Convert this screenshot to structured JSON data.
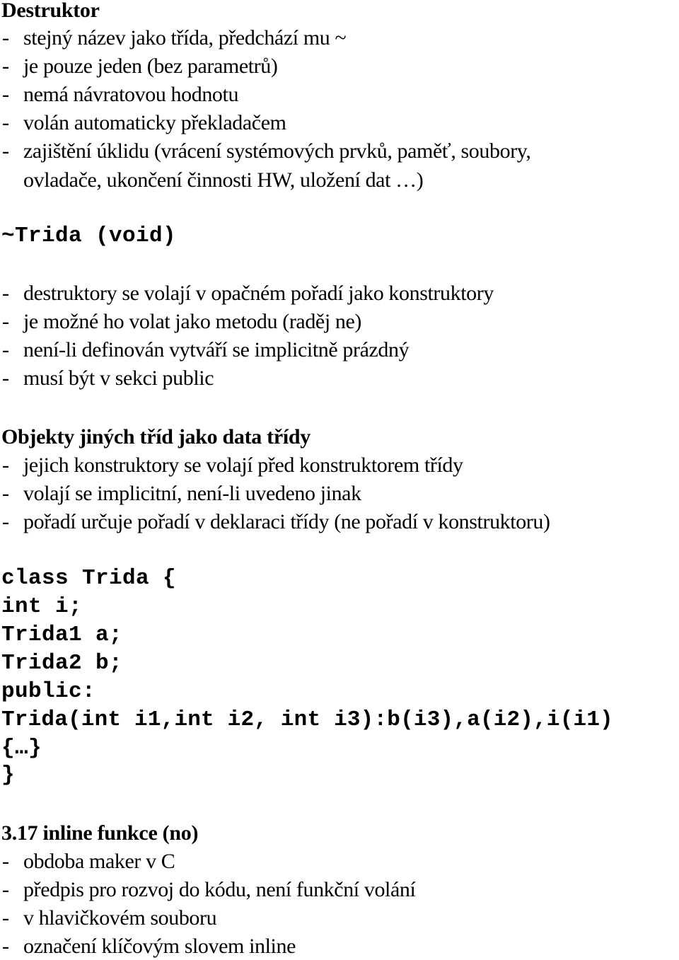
{
  "sections": {
    "destruktor": {
      "title": "Destruktor",
      "items": [
        "stejný název jako třída, předchází mu ~",
        "je pouze jeden (bez parametrů)",
        "nemá návratovou hodnotu",
        "volán automaticky překladačem",
        "zajištění úklidu (vrácení systémových prvků, paměť, soubory,"
      ],
      "item_continuation": "ovladače, ukončení činnosti HW, uložení dat …)",
      "code": "~Trida (void)",
      "notes": [
        "destruktory se volají v opačném pořadí jako konstruktory",
        "je možné ho volat jako metodu (raděj ne)",
        "není-li definován vytváří se implicitně prázdný",
        "musí být v sekci public"
      ]
    },
    "objekty": {
      "title": "Objekty jiných tříd jako data třídy",
      "items": [
        "jejich konstruktory se volají před konstruktorem třídy",
        "volají se implicitní, není-li uvedeno jinak",
        "pořadí určuje pořadí v deklaraci třídy (ne pořadí v konstruktoru)"
      ],
      "code_lines": [
        "class Trida {",
        "int i;",
        "Trida1 a;",
        "Trida2 b;",
        "public:",
        "Trida(int i1,int i2, int i3):b(i3),a(i2),i(i1)",
        "{…}",
        "}"
      ]
    },
    "inline": {
      "title": "3.17 inline funkce (no)",
      "items": [
        "obdoba maker v C",
        "předpis pro rozvoj do kódu, není funkční volání",
        "v hlavičkovém souboru",
        "označení klíčovým slovem inline"
      ]
    }
  },
  "bullet_char": "-"
}
